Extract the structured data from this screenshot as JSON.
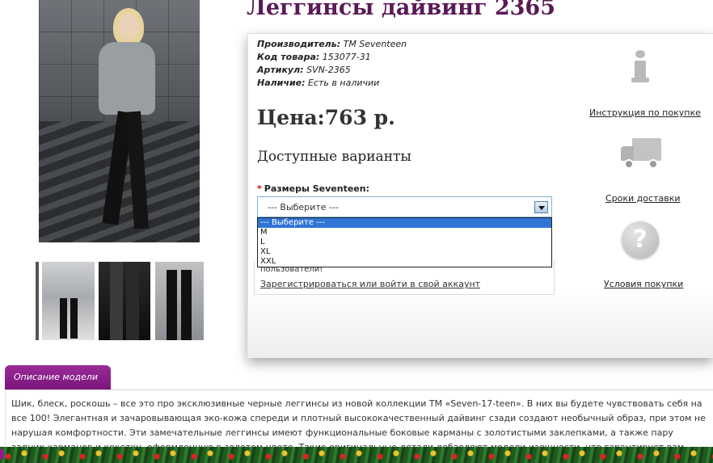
{
  "product": {
    "title": "Леггинсы дайвинг 2365",
    "specs": [
      {
        "label": "Производитель:",
        "value": "TM Seventeen"
      },
      {
        "label": "Код товара:",
        "value": "153077-31"
      },
      {
        "label": "Артикул:",
        "value": "SVN-2365"
      },
      {
        "label": "Наличие:",
        "value": "Есть в наличии"
      }
    ],
    "price": "Цена:763 р.",
    "variants_heading": "Доступные варианты",
    "size_label": "Размеры Seventeen:",
    "size_required_mark": "*",
    "size_select": {
      "selected": "--- Выберите ---",
      "options": [
        "--- Выберите ---",
        "M",
        "L",
        "XL",
        "XXL"
      ]
    },
    "login_note": "пользователи!",
    "login_link": "Зарегистрироваться или войти в свой аккаунт"
  },
  "sidebar": {
    "items": [
      {
        "label": "Инструкция по покупке",
        "icon": "info-icon"
      },
      {
        "label": "Сроки доставки",
        "icon": "truck-icon"
      },
      {
        "label": "Условия покупки",
        "icon": "question-icon"
      }
    ],
    "help_glyph": "?"
  },
  "description": {
    "tab_label": "Описание модели",
    "text": "Шик, блеск, роскошь – все это про эксклюзивные черные леггинсы из новой коллекции ТМ «Seven-17-teen». В них вы будете чувствовать себя на все 100! Элегантная и зачаровывающая эко-кожа спереди и плотный высококачественный дайвинг сзади создают необычный образ, при этом не нарушая комфортности. Эти замечательные леггинсы имеют функциональные боковые карманы с золотистыми заклепками, а также пару задних карманов и кокетку, оформленную в золотом цвете. Такие оригинальные детали добавляют модели изящности, что гарантирует вам восторженные взгляды всех вокруг! В"
  },
  "colors": {
    "title": "#5a1a56",
    "tab": "#8a208a",
    "select_highlight": "#3075d6"
  }
}
